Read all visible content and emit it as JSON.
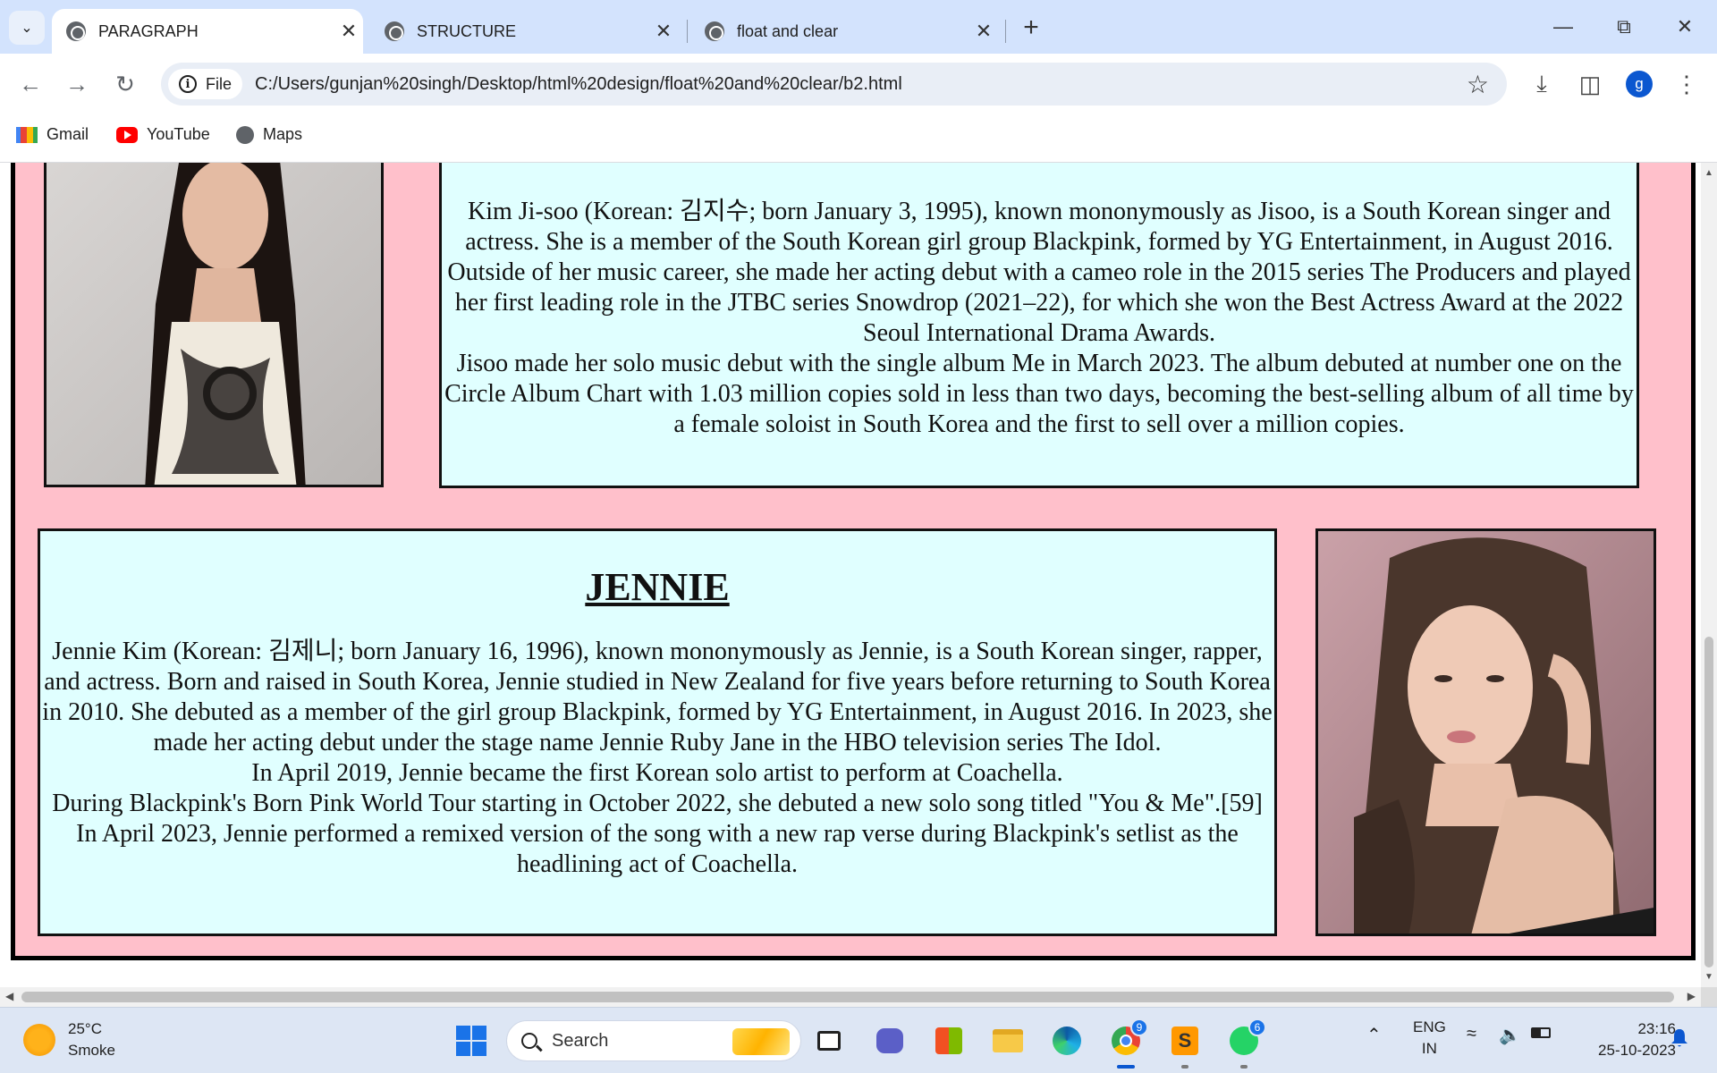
{
  "browser": {
    "tabs": [
      {
        "label": "PARAGRAPH",
        "active": true
      },
      {
        "label": "STRUCTURE",
        "active": false
      },
      {
        "label": "float and clear",
        "active": false
      }
    ],
    "address": {
      "scheme_label": "File",
      "url": "C:/Users/gunjan%20singh/Desktop/html%20design/float%20and%20clear/b2.html"
    },
    "profile_initial": "g",
    "bookmarks": [
      {
        "label": "Gmail",
        "icon": "gmail-icon"
      },
      {
        "label": "YouTube",
        "icon": "youtube-icon"
      },
      {
        "label": "Maps",
        "icon": "maps-icon"
      }
    ]
  },
  "page": {
    "jisoo": {
      "paragraphs": [
        "Kim Ji-soo (Korean: 김지수; born January 3, 1995), known mononymously as Jisoo, is a South Korean singer and actress. She is a member of the South Korean girl group Blackpink, formed by YG Entertainment, in August 2016. Outside of her music career, she made her acting debut with a cameo role in the 2015 series The Producers and played her first leading role in the JTBC series Snowdrop (2021–22), for which she won the Best Actress Award at the 2022 Seoul International Drama Awards.",
        "Jisoo made her solo music debut with the single album Me in March 2023. The album debuted at number one on the Circle Album Chart with 1.03 million copies sold in less than two days, becoming the best-selling album of all time by a female soloist in South Korea and the first to sell over a million copies."
      ]
    },
    "jennie": {
      "heading": "JENNIE",
      "paragraphs": [
        "Jennie Kim (Korean: 김제니; born January 16, 1996), known mononymously as Jennie, is a South Korean singer, rapper, and actress. Born and raised in South Korea, Jennie studied in New Zealand for five years before returning to South Korea in 2010. She debuted as a member of the girl group Blackpink, formed by YG Entertainment, in August 2016. In 2023, she made her acting debut under the stage name Jennie Ruby Jane in the HBO television series The Idol.",
        "In April 2019, Jennie became the first Korean solo artist to perform at Coachella.",
        "During Blackpink's Born Pink World Tour starting in October 2022, she debuted a new solo song titled \"You & Me\".[59] In April 2023, Jennie performed a remixed version of the song with a new rap verse during Blackpink's setlist as the headlining act of Coachella."
      ]
    },
    "colors": {
      "page_bg": "#ffc0cb",
      "card_bg": "#e0ffff",
      "border": "#000000"
    }
  },
  "taskbar": {
    "weather": {
      "temp": "25°C",
      "condition": "Smoke"
    },
    "search_placeholder": "Search",
    "chrome_badge": "9",
    "whatsapp_badge": "6",
    "language": {
      "line1": "ENG",
      "line2": "IN"
    },
    "time": "23:16",
    "date": "25-10-2023"
  }
}
